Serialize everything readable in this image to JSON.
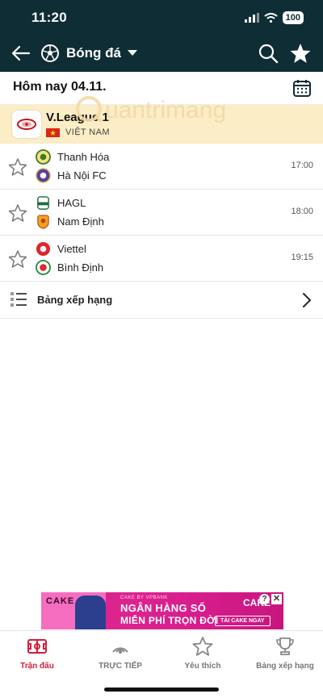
{
  "status_bar": {
    "time": "11:20",
    "battery": "100"
  },
  "header": {
    "sport_title": "Bóng đá"
  },
  "date_row": {
    "label": "Hôm nay 04.11."
  },
  "league": {
    "name": "V.League 1",
    "country": "VIỆT NAM"
  },
  "matches": [
    {
      "home": "Thanh Hóa",
      "away": "Hà Nội FC",
      "time": "17:00"
    },
    {
      "home": "HAGL",
      "away": "Nam Định",
      "time": "18:00"
    },
    {
      "home": "Viettel",
      "away": "Bình Định",
      "time": "19:15"
    }
  ],
  "standings": {
    "label": "Bảng xếp hạng"
  },
  "ad": {
    "brand_left": "CAKE",
    "small": "CAKE BY VPBANK",
    "line1": "NGÂN HÀNG SỐ",
    "line2": "MIỄN PHÍ TRỌN ĐỜI",
    "brand_right": "CAKE",
    "cta": "TẢI CAKE NGAY",
    "info": "?",
    "close": "✕"
  },
  "watermark": {
    "text": "uantrimang"
  },
  "bottom_nav": [
    {
      "label": "Trận đấu",
      "active": true
    },
    {
      "label": "TRỰC TIẾP",
      "active": false
    },
    {
      "label": "Yêu thích",
      "active": false
    },
    {
      "label": "Bảng xếp hạng",
      "active": false
    }
  ],
  "colors": {
    "header_bg": "#0f2d35",
    "league_bg": "#fbedc6",
    "accent": "#d2203c",
    "ad_bg": "#e02a8f"
  }
}
